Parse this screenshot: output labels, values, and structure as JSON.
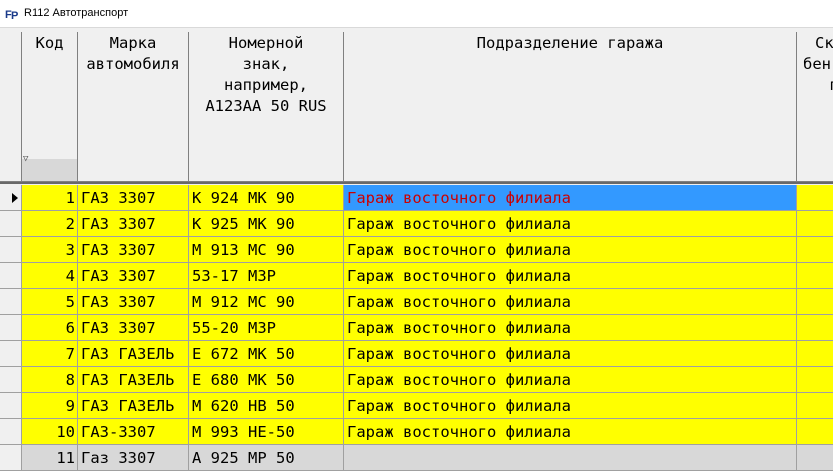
{
  "window": {
    "title": "R112 Автотранспорт",
    "app_icon": "fp-app-icon"
  },
  "colors": {
    "row_bg": "#ffff00",
    "selected_bg": "#3399ff",
    "selected_text": "#cc0000",
    "inactive_row_bg": "#d8d8d8"
  },
  "columns": [
    {
      "id": "code",
      "header": [
        "Код"
      ]
    },
    {
      "id": "brand",
      "header": [
        "Марка",
        "автомобиля"
      ]
    },
    {
      "id": "plate",
      "header": [
        "Номерной",
        "знак,",
        "например,",
        "А123АА 50 RUS"
      ]
    },
    {
      "id": "garage",
      "header": [
        "Подразделение гаража"
      ]
    },
    {
      "id": "extra",
      "header": [
        "Ск",
        "бен",
        "г"
      ]
    }
  ],
  "rows": [
    {
      "code": "1",
      "brand": "ГАЗ 3307",
      "plate": "К 924 МК 90",
      "garage": "Гараж восточного филиала",
      "current": true
    },
    {
      "code": "2",
      "brand": "ГАЗ 3307",
      "plate": "К 925 МК 90",
      "garage": "Гараж восточного филиала"
    },
    {
      "code": "3",
      "brand": "ГАЗ 3307",
      "plate": "М 913 МС 90",
      "garage": "Гараж восточного филиала"
    },
    {
      "code": "4",
      "brand": "ГАЗ 3307",
      "plate": "53-17 МЗР",
      "garage": "Гараж восточного филиала"
    },
    {
      "code": "5",
      "brand": "ГАЗ 3307",
      "plate": "М 912 МС 90",
      "garage": "Гараж восточного филиала"
    },
    {
      "code": "6",
      "brand": "ГАЗ 3307",
      "plate": "55-20 МЗР",
      "garage": "Гараж восточного филиала"
    },
    {
      "code": "7",
      "brand": "ГАЗ ГАЗЕЛЬ",
      "plate": "Е 672 МК 50",
      "garage": "Гараж восточного филиала"
    },
    {
      "code": "8",
      "brand": "ГАЗ ГАЗЕЛЬ",
      "plate": "Е 680 МК 50",
      "garage": "Гараж восточного филиала"
    },
    {
      "code": "9",
      "brand": "ГАЗ ГАЗЕЛЬ",
      "plate": "М 620 НВ 50",
      "garage": "Гараж восточного филиала"
    },
    {
      "code": "10",
      "brand": "ГАЗ-3307",
      "plate": "М 993 НЕ-50",
      "garage": "Гараж восточного филиала"
    },
    {
      "code": "11",
      "brand": "Газ 3307",
      "plate": "А 925 МР 50",
      "garage": "",
      "inactive": true
    }
  ]
}
